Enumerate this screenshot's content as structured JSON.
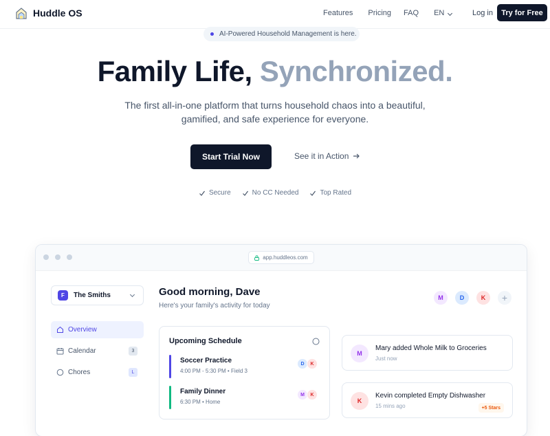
{
  "nav": {
    "brand": "Huddle OS",
    "links": {
      "features": "Features",
      "pricing": "Pricing",
      "faq": "FAQ",
      "lang": "EN"
    },
    "login": "Log in",
    "cta": "Try for Free"
  },
  "hero": {
    "badge": "AI-Powered Household Management is here.",
    "title_dark": "Family Life,",
    "title_light": "Synchronized.",
    "subtitle": "The first all-in-one platform that turns household chaos into a beautiful, gamified, and safe experience for everyone.",
    "primary_cta": "Start Trial Now",
    "secondary_cta": "See it in Action",
    "trust": [
      "Secure",
      "No CC Needed",
      "Top Rated"
    ]
  },
  "dashboard": {
    "url": "app.huddleos.com",
    "family": {
      "initial": "F",
      "name": "The Smiths"
    },
    "sidebar": [
      {
        "label": "Overview",
        "count": ""
      },
      {
        "label": "Calendar",
        "count": "3"
      },
      {
        "label": "Chores",
        "count": "L"
      }
    ],
    "greeting": "Good morning, Dave",
    "greeting_sub": "Here's your family's activity for today",
    "members": [
      "M",
      "D",
      "K",
      "+"
    ],
    "schedule": {
      "title": "Upcoming Schedule",
      "events": [
        {
          "title": "Soccer Practice",
          "meta": "4:00 PM - 5:30 PM • Field 3",
          "attendees": [
            "D",
            "K"
          ],
          "color": "#4f46e5"
        },
        {
          "title": "Family Dinner",
          "meta": "6:30 PM • Home",
          "attendees": [
            "M",
            "K"
          ],
          "color": "#10b981"
        }
      ]
    },
    "activity": [
      {
        "initial": "M",
        "text": "Mary added Whole Milk to Groceries",
        "time": "Just now",
        "badge": ""
      },
      {
        "initial": "K",
        "text": "Kevin completed Empty Dishwasher",
        "time": "15 mins ago",
        "badge": "+5 Stars"
      }
    ]
  }
}
